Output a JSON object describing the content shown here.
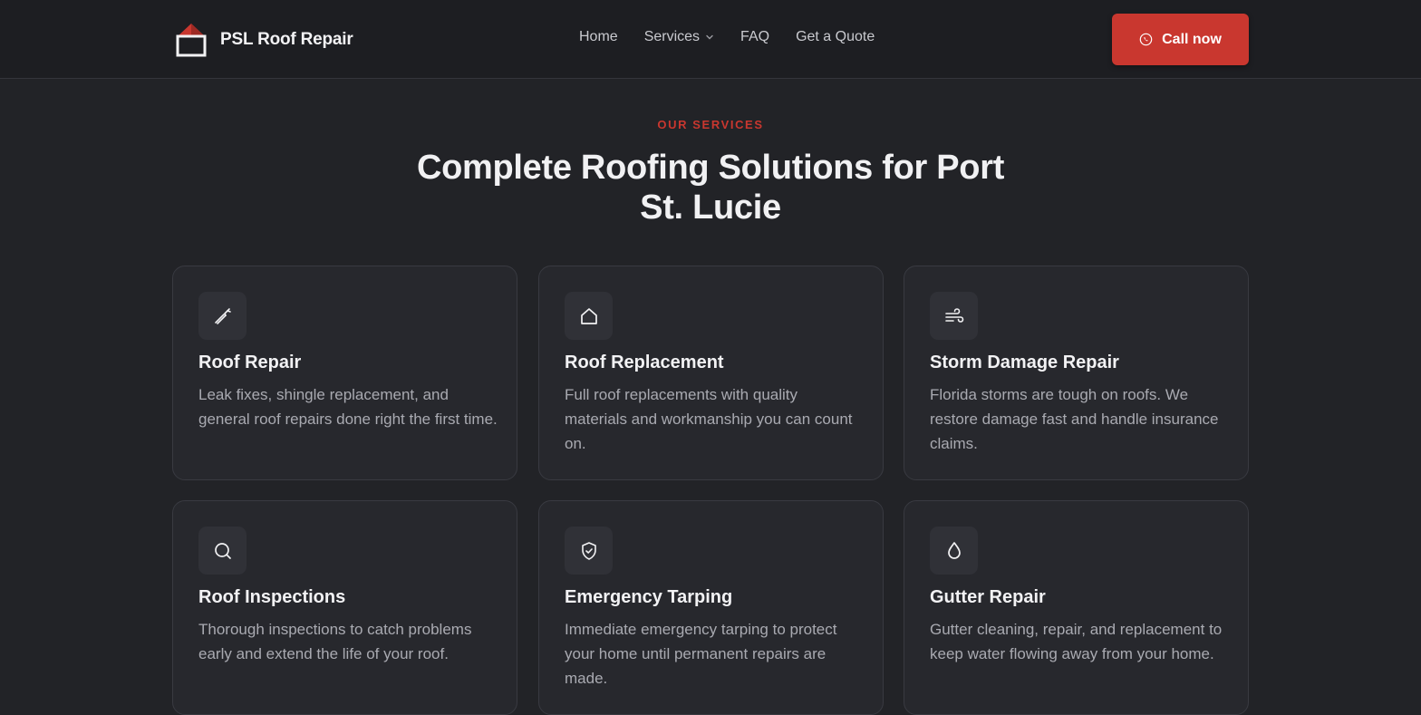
{
  "brand": {
    "name": "PSL Roof Repair",
    "accent": "#c9372f"
  },
  "nav": {
    "items": [
      {
        "label": "Home"
      },
      {
        "label": "Services"
      },
      {
        "label": "FAQ"
      },
      {
        "label": "Get a Quote"
      }
    ]
  },
  "cta": {
    "label": "Call now",
    "icon": "phone-icon"
  },
  "section": {
    "eyebrow": "OUR SERVICES",
    "title": "Complete Roofing Solutions for Port St. Lucie"
  },
  "services": [
    {
      "title": "Roof Repair",
      "description": "Leak fixes, shingle replacement, and general roof repairs done right the first time.",
      "icon": "hammer-icon"
    },
    {
      "title": "Roof Replacement",
      "description": "Full roof replacements with quality materials and workmanship you can count on.",
      "icon": "home-icon"
    },
    {
      "title": "Storm Damage Repair",
      "description": "Florida storms are tough on roofs. We restore damage fast and handle insurance claims.",
      "icon": "wind-icon"
    },
    {
      "title": "Roof Inspections",
      "description": "Thorough inspections to catch problems early and extend the life of your roof.",
      "icon": "search-icon"
    },
    {
      "title": "Emergency Tarping",
      "description": "Immediate emergency tarping to protect your home until permanent repairs are made.",
      "icon": "shield-check-icon"
    },
    {
      "title": "Gutter Repair",
      "description": "Gutter cleaning, repair, and replacement to keep water flowing away from your home.",
      "icon": "droplet-icon"
    }
  ]
}
